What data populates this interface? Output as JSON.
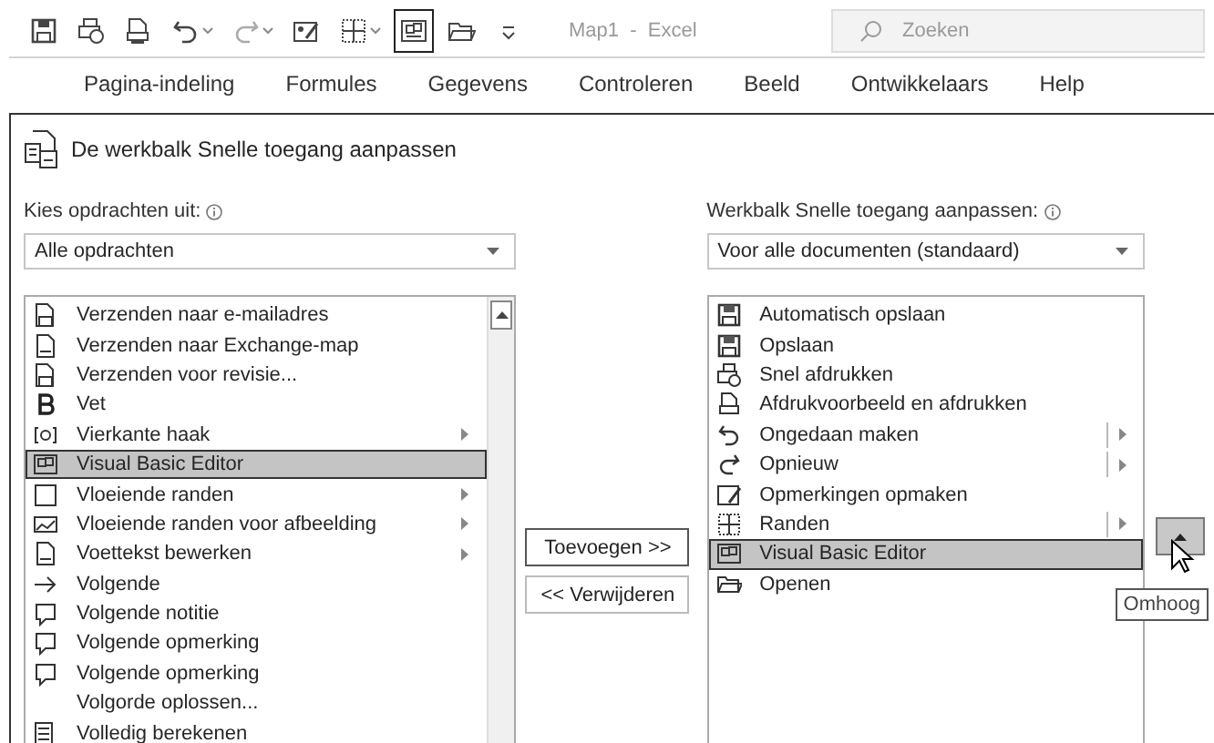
{
  "quick_access_toolbar": {
    "buttons": [
      {
        "kind": "save",
        "dropdown": false,
        "disabled": false,
        "selected": false
      },
      {
        "kind": "quickprint",
        "dropdown": false,
        "disabled": false,
        "selected": false
      },
      {
        "kind": "preview",
        "dropdown": false,
        "disabled": false,
        "selected": false
      },
      {
        "kind": "undo",
        "dropdown": true,
        "disabled": false,
        "selected": false
      },
      {
        "kind": "redo",
        "dropdown": true,
        "disabled": true,
        "selected": false
      },
      {
        "kind": "comments",
        "dropdown": false,
        "disabled": false,
        "selected": false
      },
      {
        "kind": "borders",
        "dropdown": true,
        "disabled": false,
        "selected": false
      },
      {
        "kind": "vbe",
        "dropdown": false,
        "disabled": false,
        "selected": true
      },
      {
        "kind": "open",
        "dropdown": false,
        "disabled": false,
        "selected": false
      },
      {
        "kind": "customize",
        "dropdown": false,
        "disabled": false,
        "selected": false
      }
    ],
    "title": "Map1  -  Excel",
    "search": {
      "placeholder": "Zoeken"
    }
  },
  "ribbon_tabs": [
    {
      "label": "Pagina-indeling"
    },
    {
      "label": "Formules"
    },
    {
      "label": "Gegevens"
    },
    {
      "label": "Controleren"
    },
    {
      "label": "Beeld"
    },
    {
      "label": "Ontwikkelaars"
    },
    {
      "label": "Help"
    }
  ],
  "dialog": {
    "heading": "De werkbalk Snelle toegang aanpassen",
    "left": {
      "label": "Kies opdrachten uit:",
      "dropdown": "Alle opdrachten",
      "items": [
        {
          "label": "Verzenden naar e-mailadres",
          "submenu": false,
          "selected": false
        },
        {
          "label": "Verzenden naar Exchange-map",
          "submenu": false,
          "selected": false
        },
        {
          "label": "Verzenden voor revisie...",
          "submenu": false,
          "selected": false
        },
        {
          "label": "Vet",
          "submenu": false,
          "selected": false
        },
        {
          "label": "Vierkante haak",
          "submenu": true,
          "selected": false
        },
        {
          "label": "Visual Basic Editor",
          "submenu": false,
          "selected": true
        },
        {
          "label": "Vloeiende randen",
          "submenu": true,
          "selected": false
        },
        {
          "label": "Vloeiende randen voor afbeelding",
          "submenu": true,
          "selected": false
        },
        {
          "label": "Voettekst bewerken",
          "submenu": true,
          "selected": false
        },
        {
          "label": "Volgende",
          "submenu": false,
          "selected": false
        },
        {
          "label": "Volgende notitie",
          "submenu": false,
          "selected": false
        },
        {
          "label": "Volgende opmerking",
          "submenu": false,
          "selected": false
        },
        {
          "label": "Volgende opmerking",
          "submenu": false,
          "selected": false
        },
        {
          "label": "Volgorde oplossen...",
          "submenu": false,
          "selected": false
        },
        {
          "label": "Volledig berekenen",
          "submenu": false,
          "selected": false
        }
      ]
    },
    "add_button": "Toevoegen >>",
    "remove_button": "<< Verwijderen",
    "right": {
      "label": "Werkbalk Snelle toegang aanpassen:",
      "dropdown": "Voor alle documenten (standaard)",
      "items": [
        {
          "label": "Automatisch opslaan",
          "submenu": false,
          "selected": false
        },
        {
          "label": "Opslaan",
          "submenu": false,
          "selected": false
        },
        {
          "label": "Snel afdrukken",
          "submenu": false,
          "selected": false
        },
        {
          "label": "Afdrukvoorbeeld en afdrukken",
          "submenu": false,
          "selected": false
        },
        {
          "label": "Ongedaan maken",
          "submenu": true,
          "selected": false
        },
        {
          "label": "Opnieuw",
          "submenu": true,
          "selected": false
        },
        {
          "label": "Opmerkingen opmaken",
          "submenu": false,
          "selected": false
        },
        {
          "label": "Randen",
          "submenu": true,
          "selected": false
        },
        {
          "label": "Visual Basic Editor",
          "submenu": false,
          "selected": true
        },
        {
          "label": "Openen",
          "submenu": false,
          "selected": false
        }
      ]
    },
    "tooltip": "Omhoog"
  }
}
